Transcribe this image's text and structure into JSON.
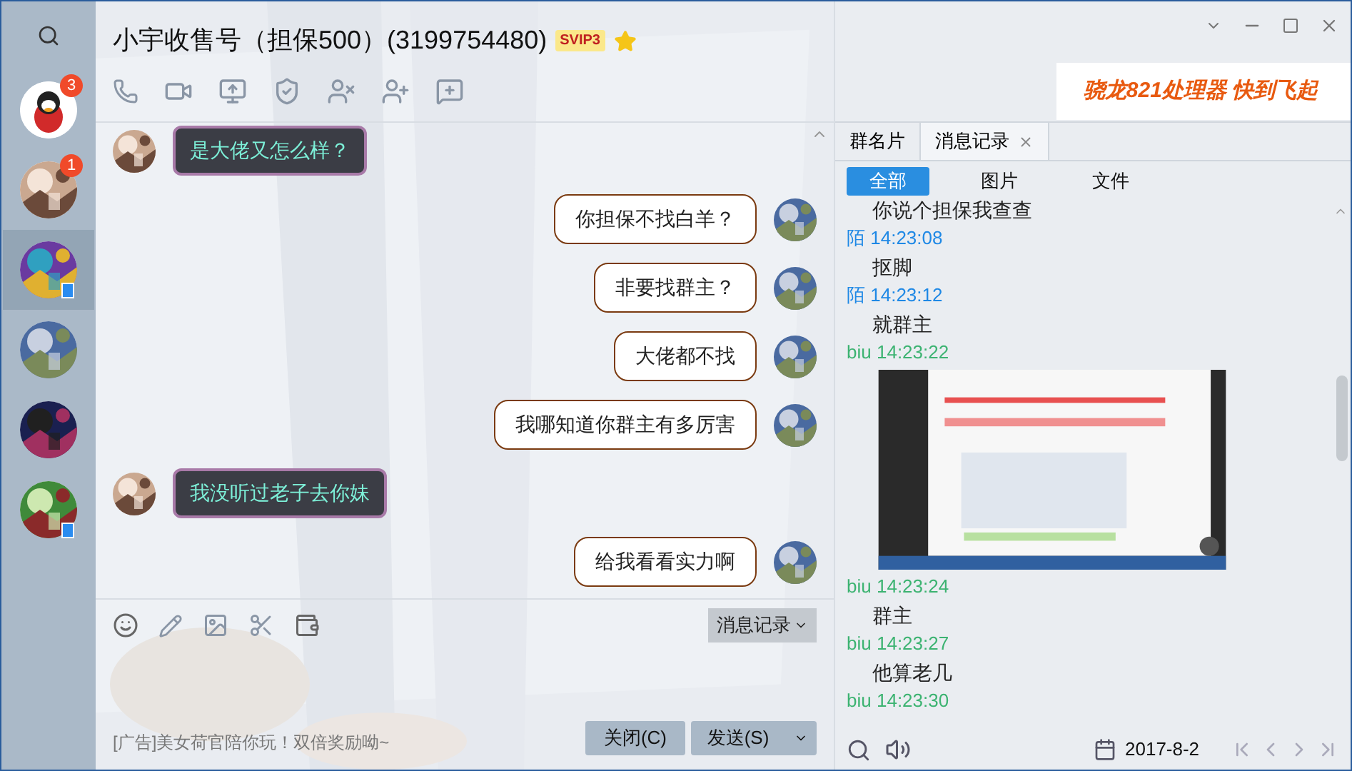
{
  "sidebar": {
    "contacts": [
      {
        "badge": "3",
        "selected": false,
        "mobile": false,
        "kind": "penguin"
      },
      {
        "badge": "1",
        "selected": false,
        "mobile": false,
        "kind": "picture"
      },
      {
        "selected": true,
        "mobile": true,
        "kind": "picture"
      },
      {
        "selected": false,
        "mobile": false,
        "kind": "picture"
      },
      {
        "selected": false,
        "mobile": false,
        "kind": "picture"
      },
      {
        "selected": false,
        "mobile": true,
        "kind": "picture"
      }
    ]
  },
  "header": {
    "title": "小宇收售号（担保500）(3199754480)",
    "vip": "SVIP3"
  },
  "ad_banner": "骁龙821处理器 快到飞起",
  "messages": [
    {
      "kind": "incoming",
      "text": "是大佬又怎么样？"
    },
    {
      "kind": "outgoing",
      "text": "你担保不找白羊？"
    },
    {
      "kind": "outgoing",
      "text": "非要找群主？"
    },
    {
      "kind": "outgoing",
      "text": "大佬都不找"
    },
    {
      "kind": "outgoing",
      "text": "我哪知道你群主有多厉害"
    },
    {
      "kind": "incoming",
      "text": "我没听过老子去你妹"
    },
    {
      "kind": "outgoing",
      "text": "给我看看实力啊"
    }
  ],
  "input": {
    "history_button": "消息记录",
    "ad": "[广告]美女荷官陪你玩！双倍奖励呦~",
    "close_button": "关闭(C)",
    "send_button": "发送(S)"
  },
  "panel": {
    "tabs": [
      {
        "label": "群名片",
        "selected": false
      },
      {
        "label": "消息记录",
        "selected": true
      }
    ],
    "filters": [
      {
        "label": "全部",
        "selected": true
      },
      {
        "label": "图片",
        "selected": false
      },
      {
        "label": "文件",
        "selected": false
      }
    ],
    "history": [
      {
        "kind": "text",
        "text": "你说个担保我查查"
      },
      {
        "kind": "header",
        "sender": "陌",
        "time": "14:23:08",
        "color": "#1e88e5"
      },
      {
        "kind": "text",
        "text": "抠脚"
      },
      {
        "kind": "header",
        "sender": "陌",
        "time": "14:23:12",
        "color": "#1e88e5"
      },
      {
        "kind": "text",
        "text": "就群主"
      },
      {
        "kind": "header",
        "sender": "biu",
        "time": "14:23:22",
        "color": "#3cb371"
      },
      {
        "kind": "picture"
      },
      {
        "kind": "header",
        "sender": "biu",
        "time": "14:23:24",
        "color": "#3cb371"
      },
      {
        "kind": "text",
        "text": "群主"
      },
      {
        "kind": "header",
        "sender": "biu",
        "time": "14:23:27",
        "color": "#3cb371"
      },
      {
        "kind": "text",
        "text": "他算老几"
      },
      {
        "kind": "header",
        "sender": "biu",
        "time": "14:23:30",
        "color": "#3cb371"
      }
    ],
    "date": "2017-8-2"
  }
}
